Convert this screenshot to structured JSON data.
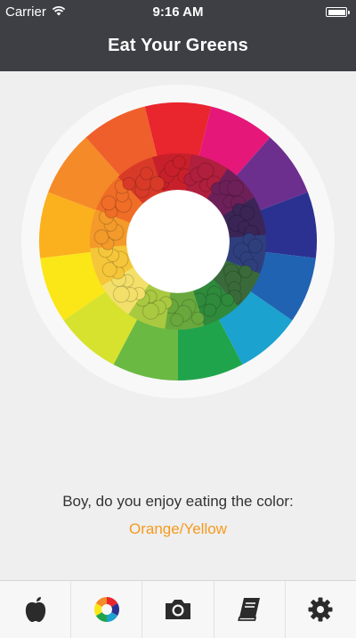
{
  "status_bar": {
    "carrier": "Carrier",
    "time": "9:16 AM"
  },
  "nav": {
    "title": "Eat Your Greens"
  },
  "wheel": {
    "segment_colors": [
      "#e9252d",
      "#e5187a",
      "#6c2f8e",
      "#2b3190",
      "#2063b2",
      "#1ba2cf",
      "#20a44b",
      "#6ab943",
      "#d7e22e",
      "#fbe617",
      "#fbb01e",
      "#f58a28",
      "#ef5f2b"
    ],
    "ring_food_colors": [
      "#c8202b",
      "#b01f3d",
      "#6d2058",
      "#3a2556",
      "#2f3f7e",
      "#3a6a3a",
      "#2f8a3c",
      "#69a83d",
      "#a9c941",
      "#f3e06a",
      "#f5c63a",
      "#f39a2a",
      "#ef6d27",
      "#d93a28"
    ]
  },
  "prompt": {
    "question": "Boy, do you enjoy eating the color:",
    "answer": "Orange/Yellow"
  },
  "tabs": [
    {
      "name": "apple-icon"
    },
    {
      "name": "color-wheel-icon"
    },
    {
      "name": "camera-icon"
    },
    {
      "name": "book-icon"
    },
    {
      "name": "gear-icon"
    }
  ]
}
